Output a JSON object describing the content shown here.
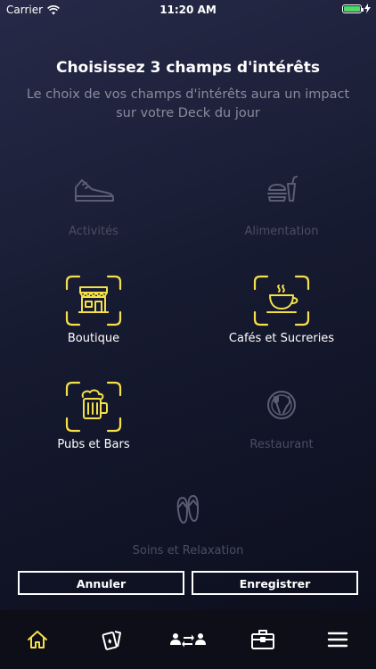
{
  "status": {
    "carrier": "Carrier",
    "time": "11:20 AM"
  },
  "header": {
    "title": "Choisissez 3 champs d'intérêts",
    "subtitle": "Le choix de vos champs d'intérêts aura un impact sur votre Deck du jour"
  },
  "categories": [
    {
      "label": "Activités",
      "icon": "sneaker-icon",
      "selected": false
    },
    {
      "label": "Alimentation",
      "icon": "fast-food-icon",
      "selected": false
    },
    {
      "label": "Boutique",
      "icon": "shop-icon",
      "selected": true
    },
    {
      "label": "Cafés et Sucreries",
      "icon": "coffee-cup-icon",
      "selected": true
    },
    {
      "label": "Pubs et Bars",
      "icon": "beer-mug-icon",
      "selected": true
    },
    {
      "label": "Restaurant",
      "icon": "plate-cutlery-icon",
      "selected": false
    },
    {
      "label": "Soins et Relaxation",
      "icon": "flip-flops-icon",
      "selected": false
    }
  ],
  "actions": {
    "cancel_label": "Annuler",
    "save_label": "Enregistrer"
  },
  "tabbar": {
    "items": [
      {
        "icon": "home-icon",
        "active": true
      },
      {
        "icon": "cards-icon",
        "active": false
      },
      {
        "icon": "people-exchange-icon",
        "active": false
      },
      {
        "icon": "briefcase-icon",
        "active": false
      },
      {
        "icon": "menu-icon",
        "active": false
      }
    ]
  },
  "colors": {
    "accent": "#f5e04a",
    "dim": "#4a4d63",
    "battery": "#4cd964"
  }
}
